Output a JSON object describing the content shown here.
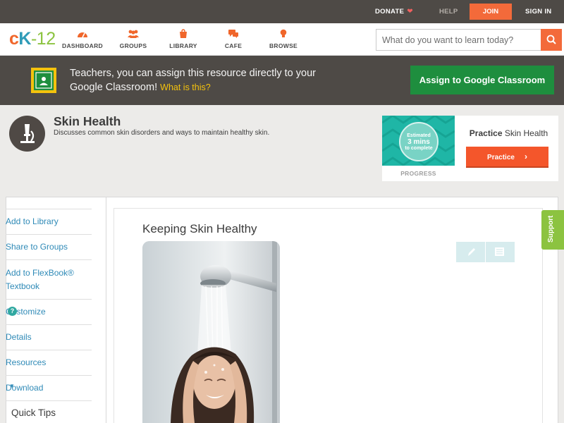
{
  "topbar": {
    "donate": "DONATE",
    "help": "HELP",
    "join": "JOIN",
    "signin": "SIGN IN"
  },
  "brand": {
    "logo_c": "c",
    "logo_k": "K",
    "logo_rest": "-12"
  },
  "nav": {
    "items": [
      {
        "label": "DASHBOARD",
        "icon": "dashboard-gauge-icon"
      },
      {
        "label": "GROUPS",
        "icon": "groups-people-icon"
      },
      {
        "label": "LIBRARY",
        "icon": "library-bag-icon"
      },
      {
        "label": "CAFE",
        "icon": "cafe-chat-icon"
      },
      {
        "label": "BROWSE",
        "icon": "browse-bulb-icon"
      }
    ],
    "search_placeholder": "What do you want to learn today?"
  },
  "classroom_banner": {
    "text": "Teachers, you can assign this resource directly to your Google Classroom!",
    "what_link": "What is this?",
    "button": "Assign to Google Classroom"
  },
  "module": {
    "title": "Skin Health",
    "description": "Discusses common skin disorders and ways to maintain healthy skin."
  },
  "practice": {
    "estimated_line1": "Estimated",
    "estimated_line2": "3 mins",
    "estimated_line3": "to complete",
    "progress_label": "PROGRESS",
    "title_bold": "Practice",
    "title_rest": " Skin Health",
    "button": "Practice"
  },
  "sidebar": {
    "items": [
      "Add to Library",
      "Share to Groups",
      "Add to FlexBook® Textbook",
      "Customize",
      "Details",
      "Resources",
      "Download"
    ],
    "quick_tips": "Quick Tips"
  },
  "content": {
    "title": "Keeping Skin Healthy"
  },
  "support": "Support",
  "colors": {
    "accent_orange": "#f36a3a",
    "link_blue": "#2f8ab7",
    "classroom_green": "#1e8e3e",
    "support_green": "#8cc340"
  }
}
